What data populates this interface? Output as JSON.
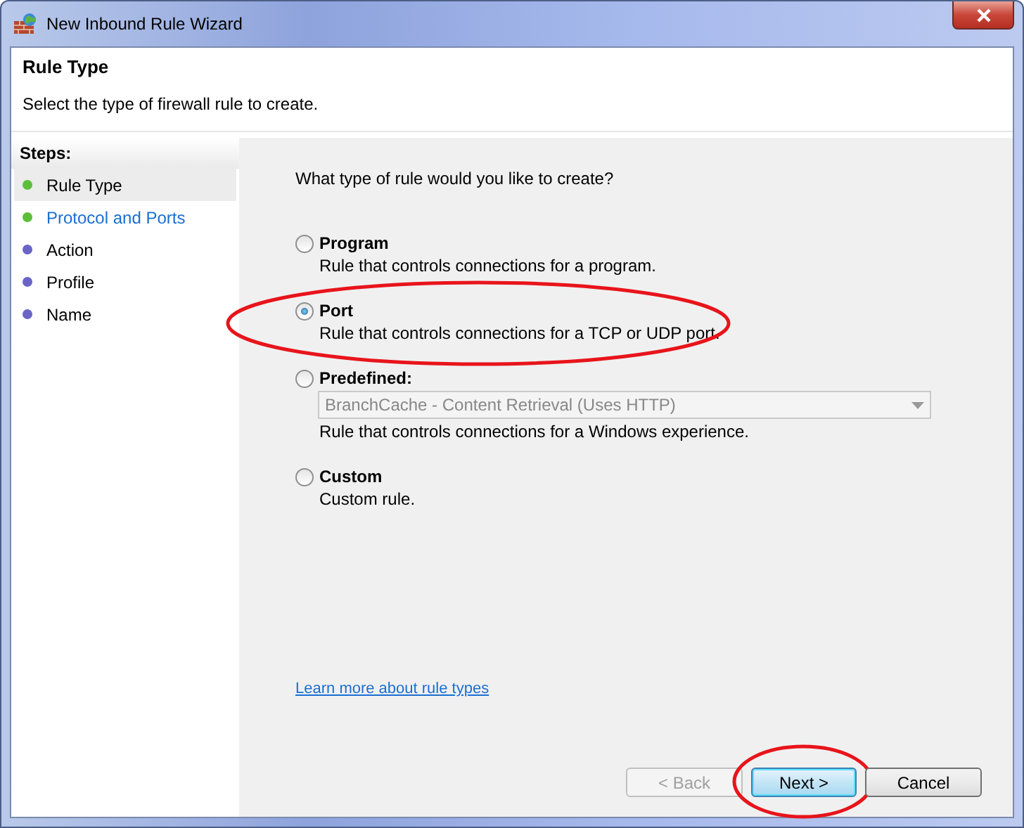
{
  "window": {
    "title": "New Inbound Rule Wizard"
  },
  "header": {
    "title": "Rule Type",
    "subtitle": "Select the type of firewall rule to create."
  },
  "steps": {
    "heading": "Steps:",
    "items": [
      {
        "label": "Rule Type",
        "selected": true,
        "color": "#5cbf3a",
        "link": false
      },
      {
        "label": "Protocol and Ports",
        "selected": false,
        "color": "#5cbf3a",
        "link": true
      },
      {
        "label": "Action",
        "selected": false,
        "color": "#6a64c8",
        "link": false
      },
      {
        "label": "Profile",
        "selected": false,
        "color": "#6a64c8",
        "link": false
      },
      {
        "label": "Name",
        "selected": false,
        "color": "#6a64c8",
        "link": false
      }
    ]
  },
  "question": "What type of rule would you like to create?",
  "options": [
    {
      "label": "Program",
      "description": "Rule that controls connections for a program.",
      "selected": false,
      "highlighted": false
    },
    {
      "label": "Port",
      "description": "Rule that controls connections for a TCP or UDP port.",
      "selected": true,
      "highlighted": true
    },
    {
      "label": "Predefined:",
      "dropdown": {
        "value": "BranchCache - Content Retrieval (Uses HTTP)",
        "disabled": true
      },
      "description": "Rule that controls connections for a Windows experience.",
      "selected": false,
      "highlighted": false
    },
    {
      "label": "Custom",
      "description": "Custom rule.",
      "selected": false,
      "highlighted": false
    }
  ],
  "link": "Learn more about rule types",
  "buttons": [
    {
      "label": "< Back",
      "disabled": true,
      "default": false,
      "highlighted": false
    },
    {
      "label": "Next >",
      "disabled": false,
      "default": true,
      "highlighted": true
    },
    {
      "label": "Cancel",
      "disabled": false,
      "default": false,
      "highlighted": false
    }
  ]
}
